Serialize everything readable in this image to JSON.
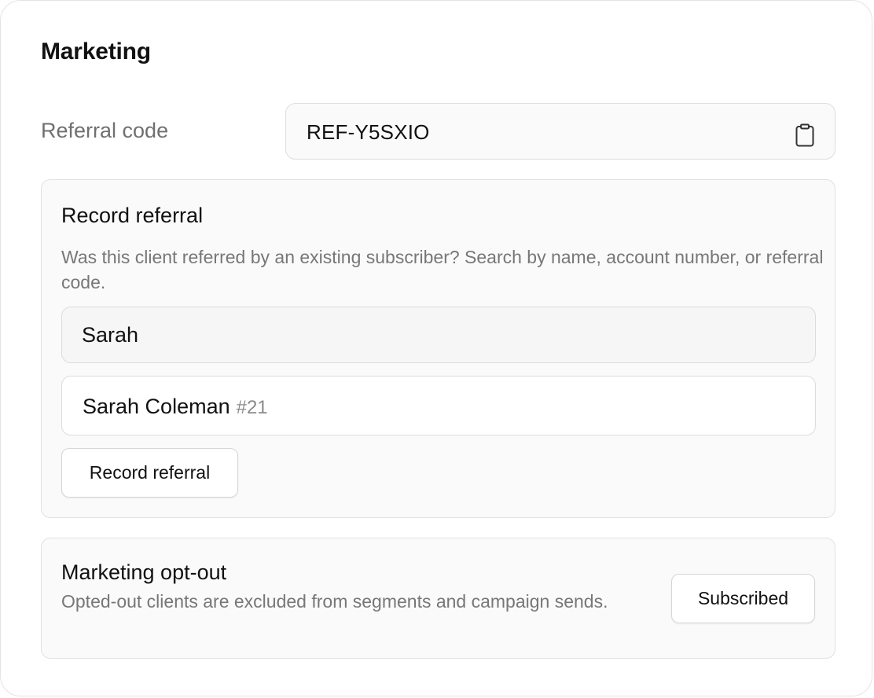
{
  "section": {
    "title": "Marketing"
  },
  "referral_code": {
    "label": "Referral code",
    "value": "REF-Y5SXIO",
    "copy_icon": "clipboard-icon"
  },
  "record_referral": {
    "title": "Record referral",
    "description": "Was this client referred by an existing subscriber? Search by name, account number, or referral code.",
    "search_value": "Sarah",
    "results": [
      {
        "name": "Sarah Coleman",
        "id": "#21"
      }
    ],
    "button_label": "Record referral"
  },
  "opt_out": {
    "title": "Marketing opt-out",
    "description": "Opted-out clients are excluded from segments and campaign sends.",
    "status_button_label": "Subscribed"
  }
}
